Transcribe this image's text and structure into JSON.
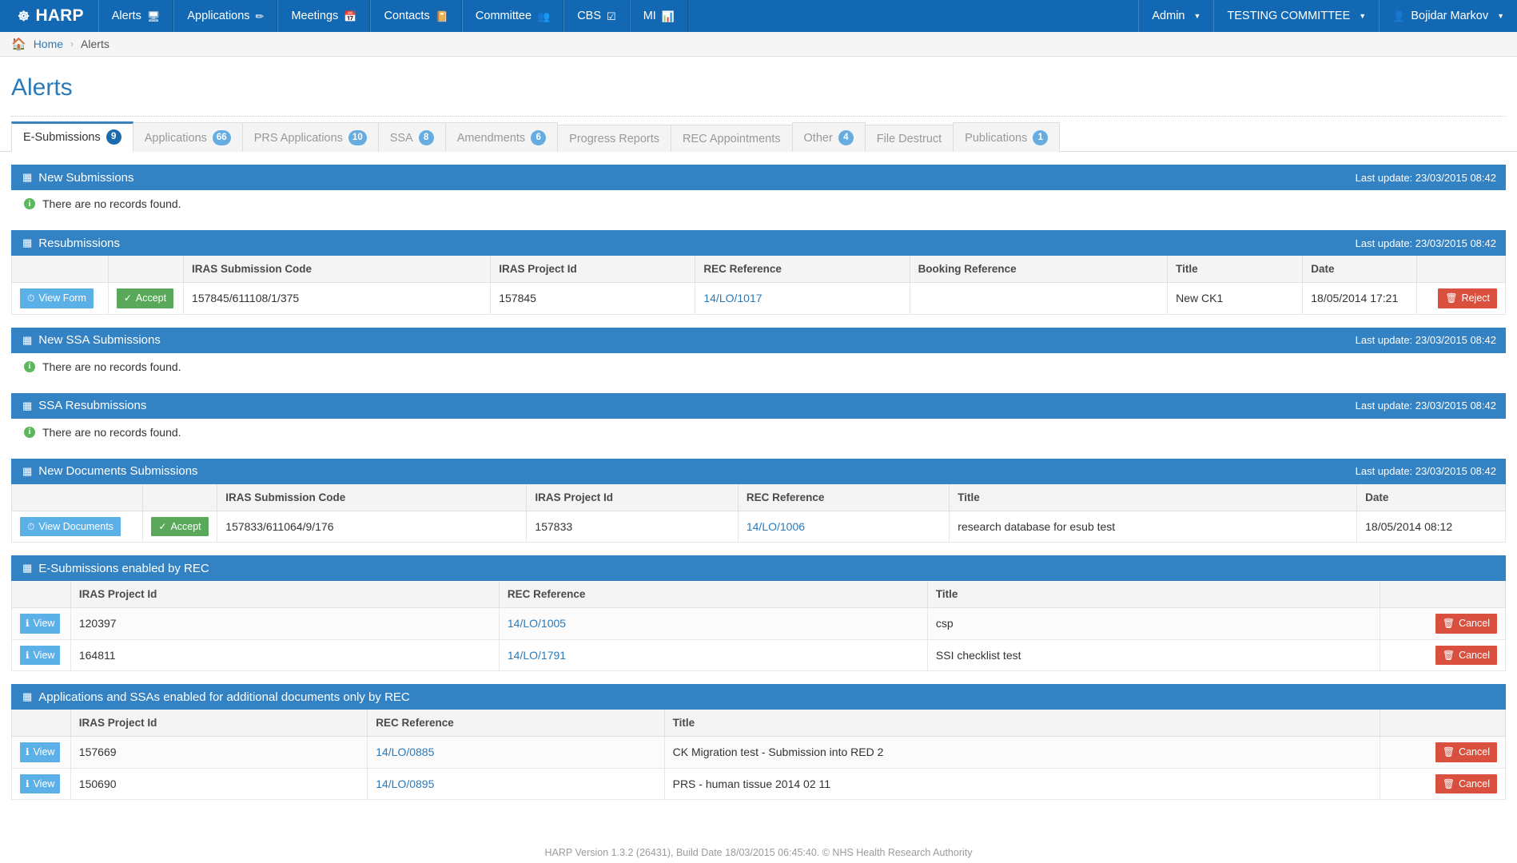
{
  "navbar": {
    "brand": "HARP",
    "brand_icon": "harp-logo-icon",
    "items": [
      {
        "label": "Alerts",
        "icon": "monitor-icon"
      },
      {
        "label": "Applications",
        "icon": "edit-square-icon"
      },
      {
        "label": "Meetings",
        "icon": "calendar-icon"
      },
      {
        "label": "Contacts",
        "icon": "book-icon"
      },
      {
        "label": "Committee",
        "icon": "group-icon"
      },
      {
        "label": "CBS",
        "icon": "check-square-icon"
      },
      {
        "label": "MI",
        "icon": "bar-chart-icon"
      }
    ],
    "right": {
      "admin": "Admin",
      "committee": "TESTING COMMITTEE",
      "user": "Bojidar Markov",
      "user_icon": "user-icon"
    }
  },
  "breadcrumb": {
    "home_icon": "home-icon",
    "home": "Home",
    "separator": "›",
    "current": "Alerts"
  },
  "page": {
    "title": "Alerts"
  },
  "tabs": [
    {
      "label": "E-Submissions",
      "badge": "9",
      "active": true
    },
    {
      "label": "Applications",
      "badge": "66",
      "active": false
    },
    {
      "label": "PRS Applications",
      "badge": "10",
      "active": false
    },
    {
      "label": "SSA",
      "badge": "8",
      "active": false
    },
    {
      "label": "Amendments",
      "badge": "6",
      "active": false
    },
    {
      "label": "Progress Reports",
      "badge": "",
      "active": false
    },
    {
      "label": "REC Appointments",
      "badge": "",
      "active": false
    },
    {
      "label": "Other",
      "badge": "4",
      "active": false
    },
    {
      "label": "File Destruct",
      "badge": "",
      "active": false
    },
    {
      "label": "Publications",
      "badge": "1",
      "active": false
    }
  ],
  "common": {
    "last_update": "Last update: 23/03/2015 08:42",
    "no_records": "There are no records found.",
    "grid_icon": "grid-icon",
    "info_icon": "info-icon",
    "btn_view_form": "View Form",
    "btn_view_documents": "View Documents",
    "btn_accept": "Accept",
    "btn_reject": "Reject",
    "btn_cancel": "Cancel",
    "btn_view": "View",
    "icon_clock": "clock-icon",
    "icon_check": "check-icon",
    "icon_trash": "trash-icon",
    "icon_info_small": "info-letter-icon"
  },
  "panels": {
    "new_submissions": {
      "title": "New Submissions",
      "last_update": "Last update: 23/03/2015 08:42",
      "empty_text": "There are no records found."
    },
    "resubmissions": {
      "title": "Resubmissions",
      "last_update": "Last update: 23/03/2015 08:42",
      "columns": [
        "",
        "",
        "IRAS Submission Code",
        "IRAS Project Id",
        "REC Reference",
        "Booking Reference",
        "Title",
        "Date",
        ""
      ],
      "rows": [
        {
          "view_label": "View Form",
          "accept_label": "Accept",
          "submission_code": "157845/611108/1/375",
          "project_id": "157845",
          "rec_reference": "14/LO/1017",
          "booking_reference": "",
          "title": "New CK1",
          "date": "18/05/2014 17:21",
          "reject_label": "Reject"
        }
      ]
    },
    "new_ssa_submissions": {
      "title": "New SSA Submissions",
      "last_update": "Last update: 23/03/2015 08:42",
      "empty_text": "There are no records found."
    },
    "ssa_resubmissions": {
      "title": "SSA Resubmissions",
      "last_update": "Last update: 23/03/2015 08:42",
      "empty_text": "There are no records found."
    },
    "new_documents_submissions": {
      "title": "New Documents Submissions",
      "last_update": "Last update: 23/03/2015 08:42",
      "columns": [
        "",
        "",
        "IRAS Submission Code",
        "IRAS Project Id",
        "REC Reference",
        "Title",
        "Date"
      ],
      "rows": [
        {
          "view_label": "View Documents",
          "accept_label": "Accept",
          "submission_code": "157833/611064/9/176",
          "project_id": "157833",
          "rec_reference": "14/LO/1006",
          "title": "research database for esub test",
          "date": "18/05/2014 08:12"
        }
      ]
    },
    "esub_enabled_by_rec": {
      "title": "E-Submissions enabled by REC",
      "columns": [
        "",
        "IRAS Project Id",
        "REC Reference",
        "Title",
        ""
      ],
      "rows": [
        {
          "view_label": "View",
          "project_id": "120397",
          "rec_reference": "14/LO/1005",
          "title": "csp",
          "cancel_label": "Cancel"
        },
        {
          "view_label": "View",
          "project_id": "164811",
          "rec_reference": "14/LO/1791",
          "title": "SSI checklist test",
          "cancel_label": "Cancel"
        }
      ]
    },
    "apps_ssas_additional_docs": {
      "title": "Applications and SSAs enabled for additional documents only by REC",
      "columns": [
        "",
        "IRAS Project Id",
        "REC Reference",
        "Title",
        ""
      ],
      "rows": [
        {
          "view_label": "View",
          "project_id": "157669",
          "rec_reference": "14/LO/0885",
          "title": "CK Migration test - Submission into RED 2",
          "cancel_label": "Cancel"
        },
        {
          "view_label": "View",
          "project_id": "150690",
          "rec_reference": "14/LO/0895",
          "title": "PRS - human tissue 2014 02 11",
          "cancel_label": "Cancel"
        }
      ]
    }
  },
  "footer": {
    "text": "HARP Version 1.3.2 (26431), Build Date 18/03/2015 06:45:40. © NHS Health Research Authority"
  },
  "colors": {
    "navbar_blue": "#1268b3",
    "panel_blue": "#3382c4",
    "link_blue": "#2a7ab9",
    "accept_green": "#5aa95a",
    "danger_red": "#d9503f",
    "info_blue": "#5bb0e8"
  }
}
